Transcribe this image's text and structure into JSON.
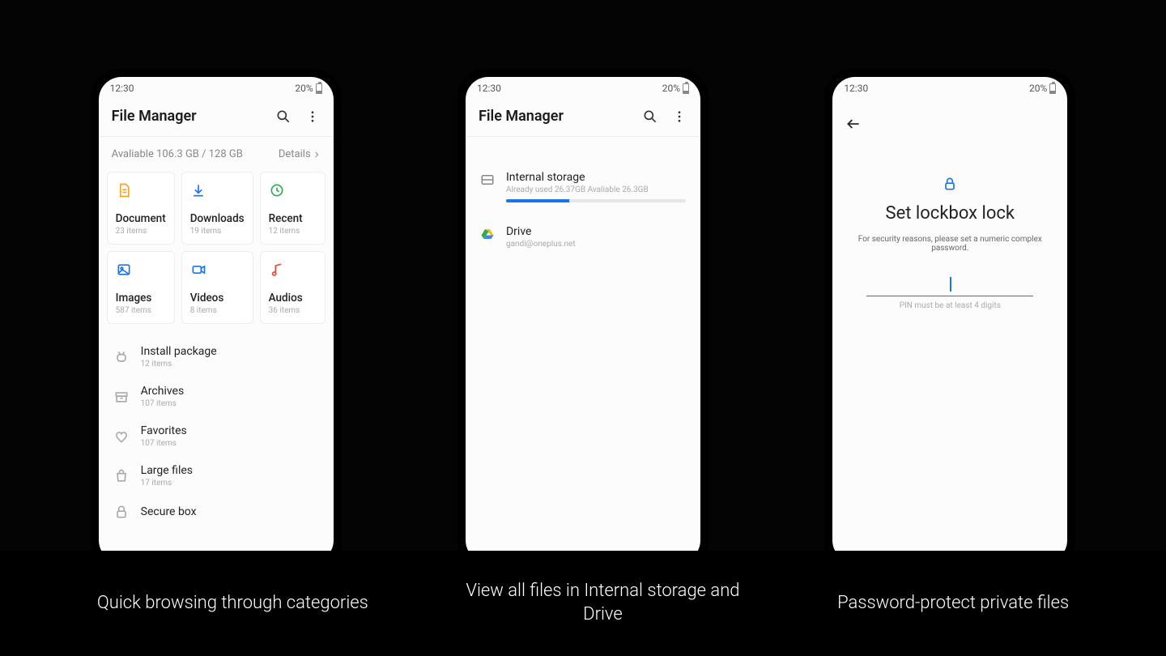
{
  "status": {
    "time": "12:30",
    "battery": "20%"
  },
  "app_title": "File Manager",
  "screen1": {
    "storage_line": "Avaliable 106.3 GB / 128 GB",
    "details_label": "Details",
    "categories": [
      {
        "name": "Document",
        "count": "23 items",
        "icon": "document",
        "color": "#f5a623"
      },
      {
        "name": "Downloads",
        "count": "19 items",
        "icon": "download",
        "color": "#1a73e8"
      },
      {
        "name": "Recent",
        "count": "12 items",
        "icon": "clock",
        "color": "#34a853"
      },
      {
        "name": "Images",
        "count": "587 items",
        "icon": "image",
        "color": "#1a73e8"
      },
      {
        "name": "Videos",
        "count": "8 items",
        "icon": "video",
        "color": "#1a73e8"
      },
      {
        "name": "Audios",
        "count": "36 items",
        "icon": "audio",
        "color": "#ea4335"
      }
    ],
    "list": [
      {
        "name": "Install package",
        "count": "12 items",
        "icon": "android"
      },
      {
        "name": "Archives",
        "count": "107 items",
        "icon": "archive"
      },
      {
        "name": "Favorites",
        "count": "107 items",
        "icon": "heart"
      },
      {
        "name": "Large files",
        "count": "17 items",
        "icon": "bag"
      },
      {
        "name": "Secure box",
        "count": "",
        "icon": "lock"
      }
    ]
  },
  "screen2": {
    "internal": {
      "name": "Internal storage",
      "sub": "Already used 26.37GB Avaliable 26.3GB"
    },
    "drive": {
      "name": "Drive",
      "sub": "gandi@oneplus.net"
    }
  },
  "screen3": {
    "title": "Set lockbox lock",
    "sub": "For security reasons, please set a numeric complex password.",
    "hint": "PIN must be at least 4 digits"
  },
  "captions": [
    "Quick browsing through categories",
    "View all files in Internal storage and Drive",
    "Password-protect private files"
  ]
}
